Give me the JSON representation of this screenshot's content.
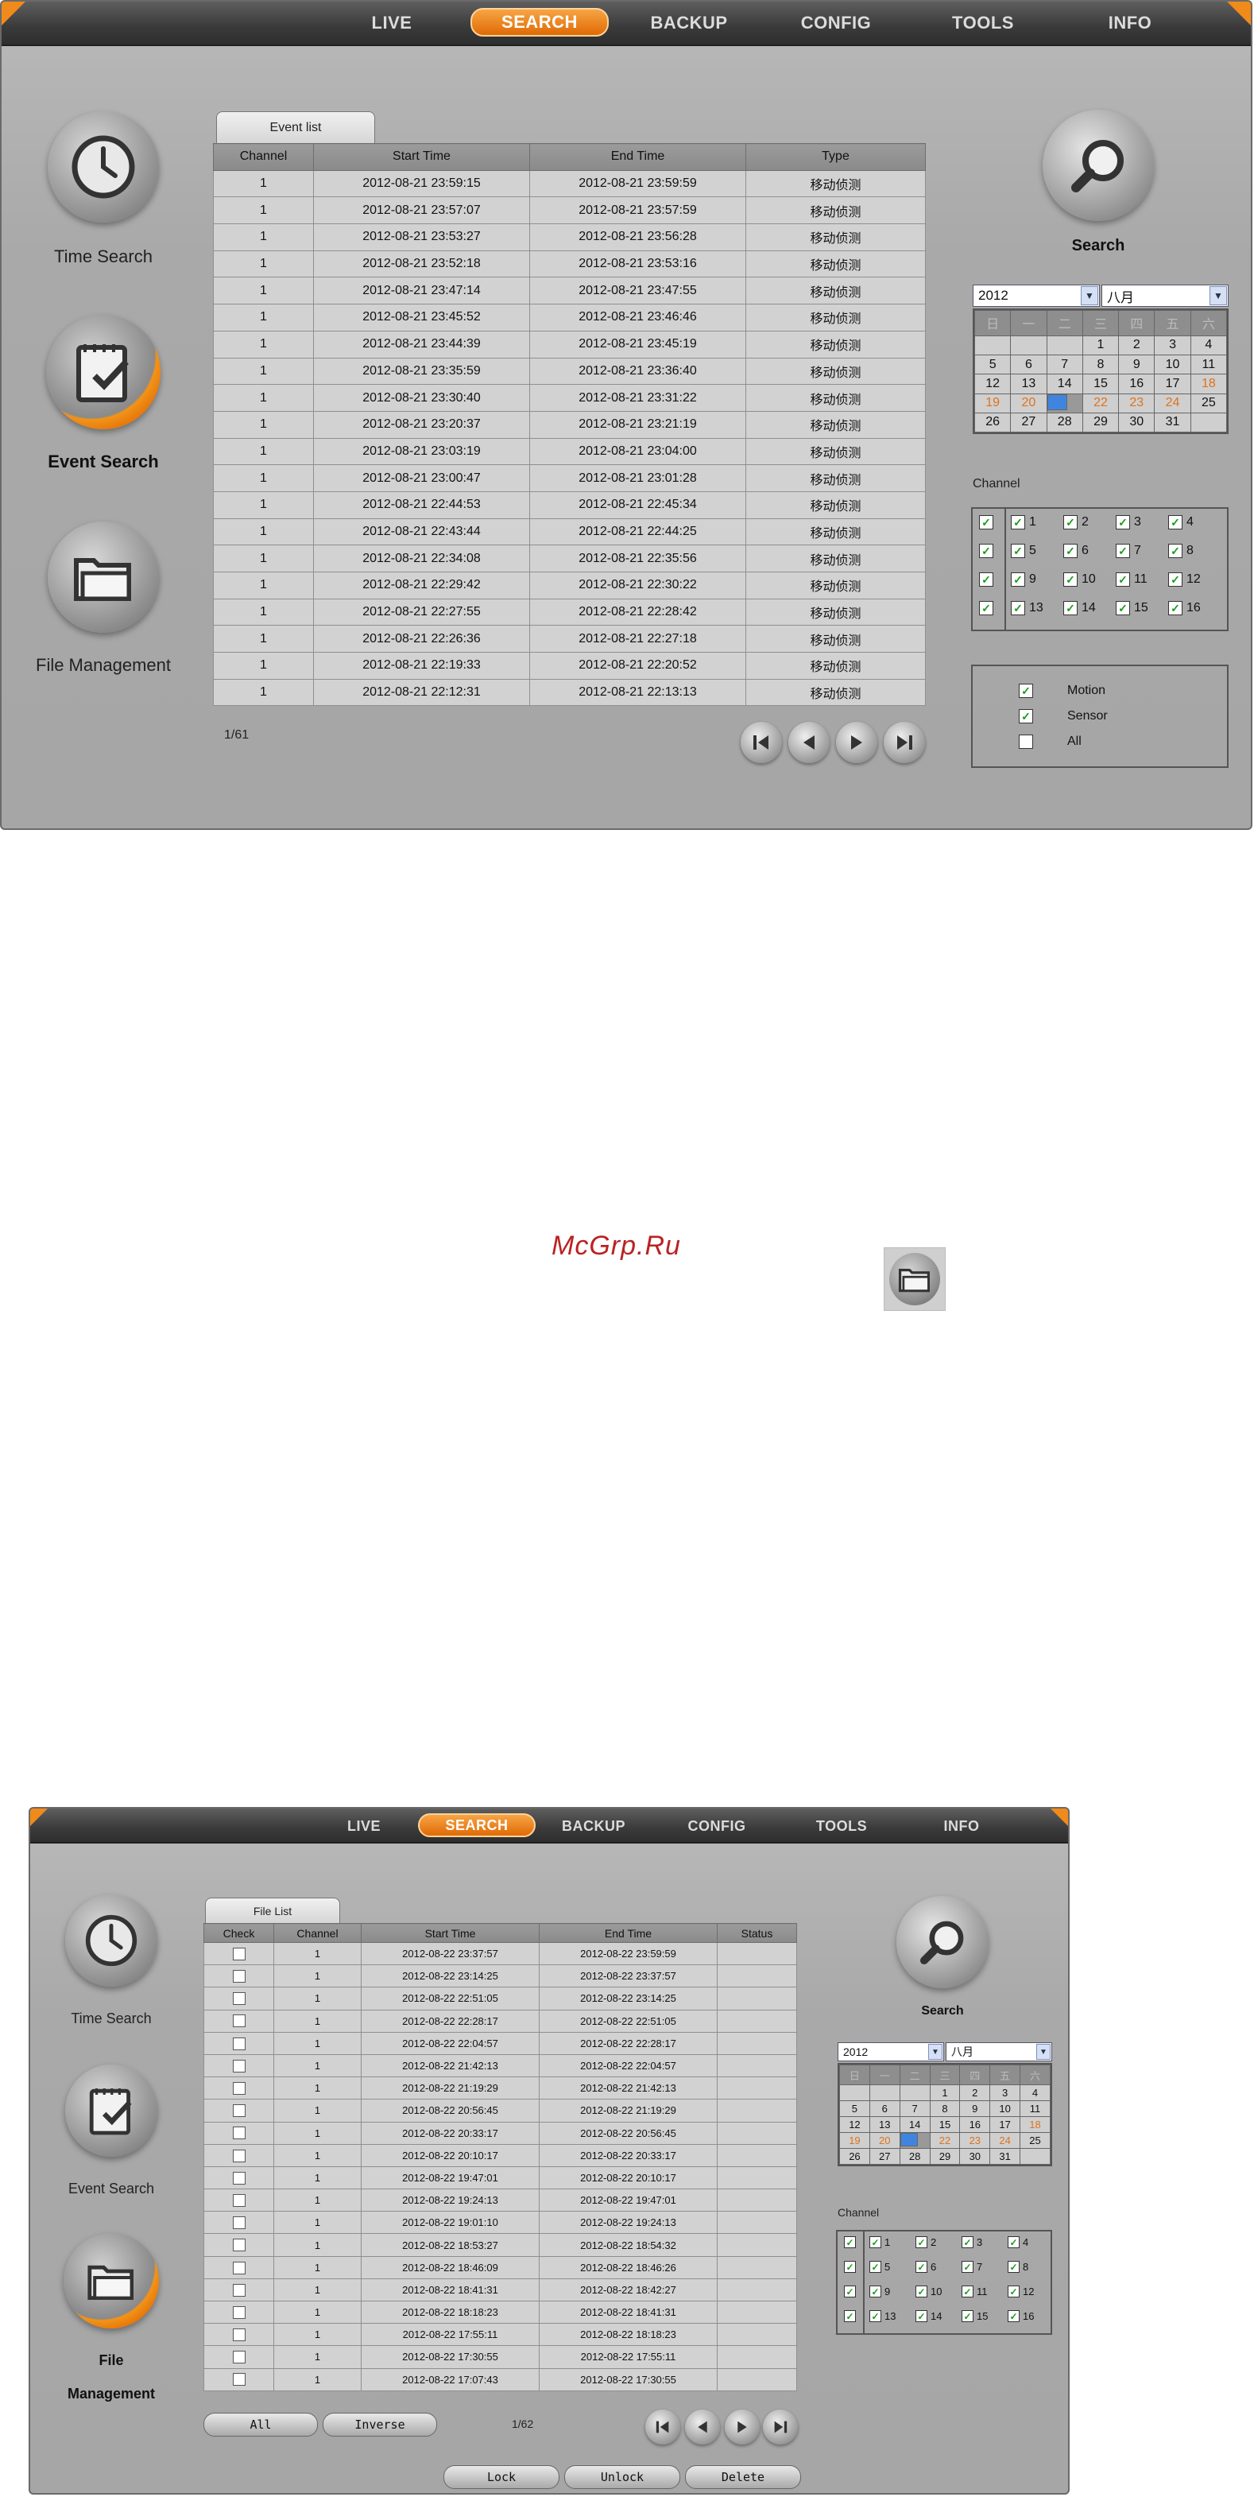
{
  "nav": [
    "LIVE",
    "SEARCH",
    "BACKUP",
    "CONFIG",
    "TOOLS",
    "INFO"
  ],
  "screen1": {
    "sidebar": {
      "time_search": "Time Search",
      "event_search": "Event Search",
      "file_management": "File Management"
    },
    "tab_label": "Event list",
    "columns": [
      "Channel",
      "Start Time",
      "End Time",
      "Type"
    ],
    "rows": [
      [
        "1",
        "2012-08-21 23:59:15",
        "2012-08-21 23:59:59",
        "移动侦测"
      ],
      [
        "1",
        "2012-08-21 23:57:07",
        "2012-08-21 23:57:59",
        "移动侦测"
      ],
      [
        "1",
        "2012-08-21 23:53:27",
        "2012-08-21 23:56:28",
        "移动侦测"
      ],
      [
        "1",
        "2012-08-21 23:52:18",
        "2012-08-21 23:53:16",
        "移动侦测"
      ],
      [
        "1",
        "2012-08-21 23:47:14",
        "2012-08-21 23:47:55",
        "移动侦测"
      ],
      [
        "1",
        "2012-08-21 23:45:52",
        "2012-08-21 23:46:46",
        "移动侦测"
      ],
      [
        "1",
        "2012-08-21 23:44:39",
        "2012-08-21 23:45:19",
        "移动侦测"
      ],
      [
        "1",
        "2012-08-21 23:35:59",
        "2012-08-21 23:36:40",
        "移动侦测"
      ],
      [
        "1",
        "2012-08-21 23:30:40",
        "2012-08-21 23:31:22",
        "移动侦测"
      ],
      [
        "1",
        "2012-08-21 23:20:37",
        "2012-08-21 23:21:19",
        "移动侦测"
      ],
      [
        "1",
        "2012-08-21 23:03:19",
        "2012-08-21 23:04:00",
        "移动侦测"
      ],
      [
        "1",
        "2012-08-21 23:00:47",
        "2012-08-21 23:01:28",
        "移动侦测"
      ],
      [
        "1",
        "2012-08-21 22:44:53",
        "2012-08-21 22:45:34",
        "移动侦测"
      ],
      [
        "1",
        "2012-08-21 22:43:44",
        "2012-08-21 22:44:25",
        "移动侦测"
      ],
      [
        "1",
        "2012-08-21 22:34:08",
        "2012-08-21 22:35:56",
        "移动侦测"
      ],
      [
        "1",
        "2012-08-21 22:29:42",
        "2012-08-21 22:30:22",
        "移动侦测"
      ],
      [
        "1",
        "2012-08-21 22:27:55",
        "2012-08-21 22:28:42",
        "移动侦测"
      ],
      [
        "1",
        "2012-08-21 22:26:36",
        "2012-08-21 22:27:18",
        "移动侦测"
      ],
      [
        "1",
        "2012-08-21 22:19:33",
        "2012-08-21 22:20:52",
        "移动侦测"
      ],
      [
        "1",
        "2012-08-21 22:12:31",
        "2012-08-21 22:13:13",
        "移动侦测"
      ]
    ],
    "page": "1/61",
    "search_label": "Search",
    "year": "2012",
    "month": "八月",
    "channel_label": "Channel",
    "types": [
      {
        "label": "Motion",
        "checked": true
      },
      {
        "label": "Sensor",
        "checked": true
      },
      {
        "label": "All",
        "checked": false
      }
    ]
  },
  "watermark": "McGrp.Ru",
  "screen2": {
    "sidebar": {
      "time_search": "Time Search",
      "event_search": "Event Search",
      "file_label_1": "File",
      "file_label_2": "Management"
    },
    "tab_label": "File List",
    "columns": [
      "Check",
      "Channel",
      "Start Time",
      "End Time",
      "Status"
    ],
    "rows": [
      [
        "",
        "1",
        "2012-08-22 23:37:57",
        "2012-08-22 23:59:59",
        ""
      ],
      [
        "",
        "1",
        "2012-08-22 23:14:25",
        "2012-08-22 23:37:57",
        ""
      ],
      [
        "",
        "1",
        "2012-08-22 22:51:05",
        "2012-08-22 23:14:25",
        ""
      ],
      [
        "",
        "1",
        "2012-08-22 22:28:17",
        "2012-08-22 22:51:05",
        ""
      ],
      [
        "",
        "1",
        "2012-08-22 22:04:57",
        "2012-08-22 22:28:17",
        ""
      ],
      [
        "",
        "1",
        "2012-08-22 21:42:13",
        "2012-08-22 22:04:57",
        ""
      ],
      [
        "",
        "1",
        "2012-08-22 21:19:29",
        "2012-08-22 21:42:13",
        ""
      ],
      [
        "",
        "1",
        "2012-08-22 20:56:45",
        "2012-08-22 21:19:29",
        ""
      ],
      [
        "",
        "1",
        "2012-08-22 20:33:17",
        "2012-08-22 20:56:45",
        ""
      ],
      [
        "",
        "1",
        "2012-08-22 20:10:17",
        "2012-08-22 20:33:17",
        ""
      ],
      [
        "",
        "1",
        "2012-08-22 19:47:01",
        "2012-08-22 20:10:17",
        ""
      ],
      [
        "",
        "1",
        "2012-08-22 19:24:13",
        "2012-08-22 19:47:01",
        ""
      ],
      [
        "",
        "1",
        "2012-08-22 19:01:10",
        "2012-08-22 19:24:13",
        ""
      ],
      [
        "",
        "1",
        "2012-08-22 18:53:27",
        "2012-08-22 18:54:32",
        ""
      ],
      [
        "",
        "1",
        "2012-08-22 18:46:09",
        "2012-08-22 18:46:26",
        ""
      ],
      [
        "",
        "1",
        "2012-08-22 18:41:31",
        "2012-08-22 18:42:27",
        ""
      ],
      [
        "",
        "1",
        "2012-08-22 18:18:23",
        "2012-08-22 18:41:31",
        ""
      ],
      [
        "",
        "1",
        "2012-08-22 17:55:11",
        "2012-08-22 18:18:23",
        ""
      ],
      [
        "",
        "1",
        "2012-08-22 17:30:55",
        "2012-08-22 17:55:11",
        ""
      ],
      [
        "",
        "1",
        "2012-08-22 17:07:43",
        "2012-08-22 17:30:55",
        ""
      ]
    ],
    "page": "1/62",
    "buttons": {
      "all": "All",
      "inverse": "Inverse",
      "lock": "Lock",
      "unlock": "Unlock",
      "delete": "Delete"
    },
    "search_label": "Search",
    "year": "2012",
    "month": "八月",
    "channel_label": "Channel"
  },
  "calendar": {
    "weekdays": [
      "日",
      "一",
      "二",
      "三",
      "四",
      "五",
      "六"
    ],
    "weeks": [
      [
        "",
        "",
        "",
        "1",
        "2",
        "3",
        "4"
      ],
      [
        "5",
        "6",
        "7",
        "8",
        "9",
        "10",
        "11"
      ],
      [
        "12",
        "13",
        "14",
        "15",
        "16",
        "17",
        "18"
      ],
      [
        "19",
        "20",
        "21",
        "22",
        "23",
        "24",
        "25"
      ],
      [
        "26",
        "27",
        "28",
        "29",
        "30",
        "31",
        ""
      ]
    ],
    "selected_day": "21"
  },
  "channels": [
    "1",
    "2",
    "3",
    "4",
    "5",
    "6",
    "7",
    "8",
    "9",
    "10",
    "11",
    "12",
    "13",
    "14",
    "15",
    "16"
  ],
  "colors": {
    "accent": "#e8761a",
    "selected": "#3f85e0",
    "check": "#1a9a1a"
  }
}
